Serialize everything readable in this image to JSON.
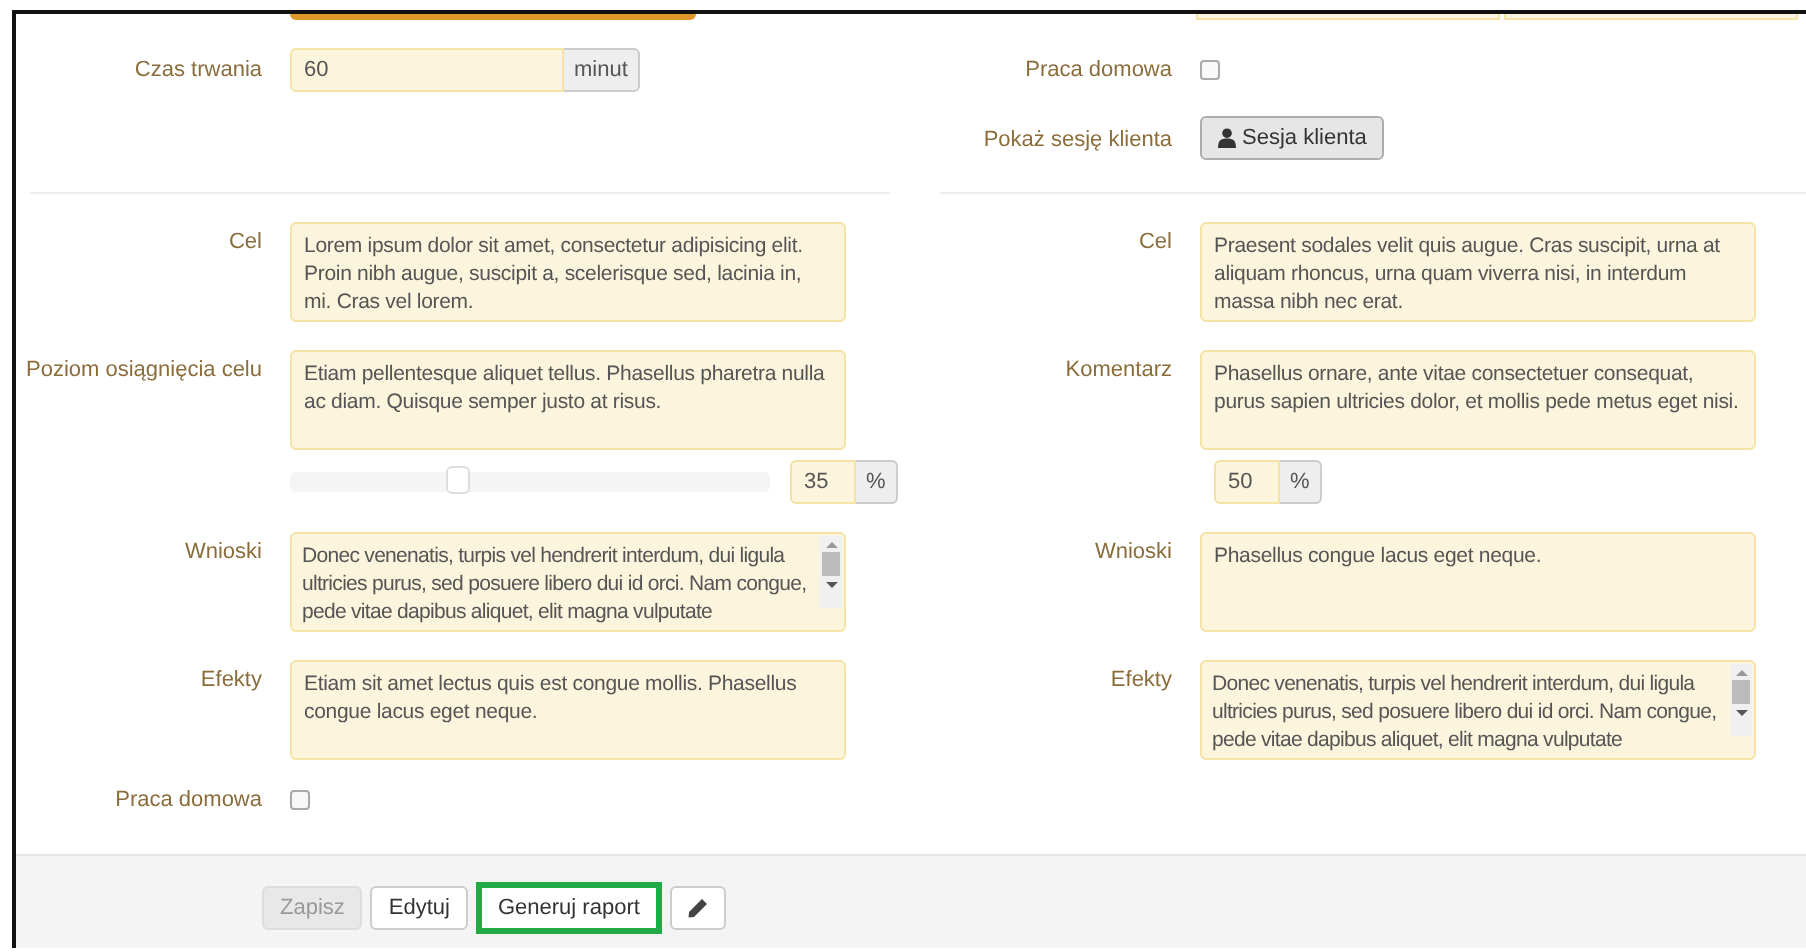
{
  "top_left": {
    "label": "Czas trwania",
    "value": "60",
    "unit": "minut"
  },
  "top_right": {
    "homework": {
      "label": "Praca domowa",
      "checked": false
    },
    "session": {
      "label": "Pokaż sesję klienta",
      "button": "Sesja klienta"
    }
  },
  "left_fields": [
    {
      "kind": "textarea",
      "label": "Cel",
      "text": "Lorem ipsum dolor sit amet, consectetur adipisicing elit. Proin nibh augue, suscipit a, scelerisque sed, lacinia in, mi. Cras vel lorem.",
      "scrollable": false
    },
    {
      "kind": "textarea",
      "label": "Poziom osiągnięcia celu",
      "text": "Etiam pellentesque aliquet tellus. Phasellus pharetra nulla ac diam. Quisque semper justo at risus.",
      "scrollable": false
    },
    {
      "kind": "slider",
      "level": 0.35,
      "value": "35",
      "unit": "%"
    },
    {
      "kind": "textarea",
      "label": "Wnioski",
      "text": "Donec venenatis, turpis vel hendrerit interdum, dui ligula ultricies purus, sed posuere libero dui id orci. Nam congue, pede vitae dapibus aliquet, elit magna vulputate",
      "scrollable": true
    },
    {
      "kind": "textarea",
      "label": "Efekty",
      "text": "Etiam sit amet lectus quis est congue mollis. Phasellus congue lacus eget neque.",
      "scrollable": false
    },
    {
      "kind": "checkbox",
      "label": "Praca domowa",
      "checked": false
    }
  ],
  "right_fields": [
    {
      "kind": "textarea",
      "label": "Cel",
      "text": "Praesent sodales velit quis augue. Cras suscipit, urna at aliquam rhoncus, urna quam viverra nisi, in interdum massa nibh nec erat.",
      "scrollable": false
    },
    {
      "kind": "textarea",
      "label": "Komentarz",
      "text": "Phasellus ornare, ante vitae consectetuer consequat, purus sapien ultricies dolor, et mollis pede metus eget nisi.",
      "scrollable": false
    },
    {
      "kind": "percent",
      "value": "50",
      "unit": "%"
    },
    {
      "kind": "textarea",
      "label": "Wnioski",
      "text": "Phasellus congue lacus eget neque.",
      "scrollable": false
    },
    {
      "kind": "textarea",
      "label": "Efekty",
      "text": "Donec venenatis, turpis vel hendrerit interdum, dui ligula ultricies purus, sed posuere libero dui id orci. Nam congue, pede vitae dapibus aliquet, elit magna vulputate",
      "scrollable": true
    }
  ],
  "footer_buttons": [
    {
      "kind": "text",
      "label": "Zapisz",
      "disabled": true,
      "highlighted": false
    },
    {
      "kind": "text",
      "label": "Edytuj",
      "disabled": false,
      "highlighted": false
    },
    {
      "kind": "text",
      "label": "Generuj raport",
      "disabled": false,
      "highlighted": true
    },
    {
      "kind": "edit",
      "disabled": false,
      "highlighted": false
    }
  ]
}
